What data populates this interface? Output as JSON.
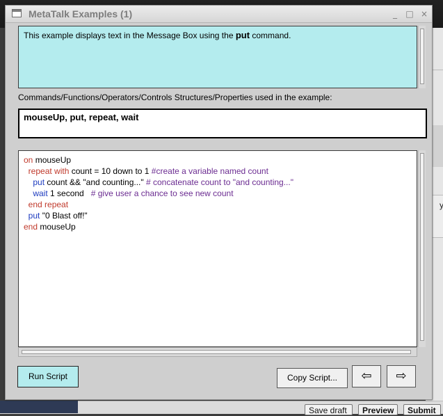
{
  "window": {
    "title": "MetaTalk Examples (1)",
    "controls": {
      "minimize": "_",
      "maximize": "□",
      "close": "×"
    }
  },
  "description": {
    "prefix": "This example displays text in the Message Box using the ",
    "keyword": "put",
    "suffix": " command."
  },
  "commands": {
    "label": "Commands/Functions/Operators/Controls Structures/Properties used in the example:",
    "value": "mouseUp, put, repeat, wait"
  },
  "script": {
    "lines": [
      {
        "indent": "",
        "parts": [
          {
            "t": "on",
            "c": "kw"
          },
          {
            "t": " mouseUp",
            "c": ""
          }
        ]
      },
      {
        "indent": "  ",
        "parts": [
          {
            "t": "repeat with",
            "c": "kw"
          },
          {
            "t": " count = 10 down to 1 ",
            "c": ""
          },
          {
            "t": "#create a variable named count",
            "c": "cmt"
          }
        ]
      },
      {
        "indent": "    ",
        "parts": [
          {
            "t": "put",
            "c": "cmd"
          },
          {
            "t": " count && \"and counting...\" ",
            "c": ""
          },
          {
            "t": "# concatenate count to \"and counting...\"",
            "c": "cmt"
          }
        ]
      },
      {
        "indent": "    ",
        "parts": [
          {
            "t": "wait",
            "c": "cmd"
          },
          {
            "t": " 1 second   ",
            "c": ""
          },
          {
            "t": "# give user a chance to see new count",
            "c": "cmt"
          }
        ]
      },
      {
        "indent": "  ",
        "parts": [
          {
            "t": "end repeat",
            "c": "kw"
          }
        ]
      },
      {
        "indent": "  ",
        "parts": [
          {
            "t": "put",
            "c": "cmd"
          },
          {
            "t": " \"0 Blast off!\"",
            "c": ""
          }
        ]
      },
      {
        "indent": "",
        "parts": [
          {
            "t": "end",
            "c": "kw"
          },
          {
            "t": " mouseUp",
            "c": ""
          }
        ]
      }
    ]
  },
  "buttons": {
    "run": "Run Script",
    "copy": "Copy Script...",
    "prev_icon": "arrow-left-icon",
    "next_icon": "arrow-right-icon",
    "prev_glyph": "⇦",
    "next_glyph": "⇨"
  },
  "background": {
    "peek_char": "y",
    "save_draft": "Save draft",
    "preview": "Preview",
    "submit": "Submit"
  },
  "colors": {
    "accent_cyan": "#b4ecee",
    "keyword": "#c0392b",
    "comment": "#6b2c91",
    "command": "#1d3bbf"
  }
}
